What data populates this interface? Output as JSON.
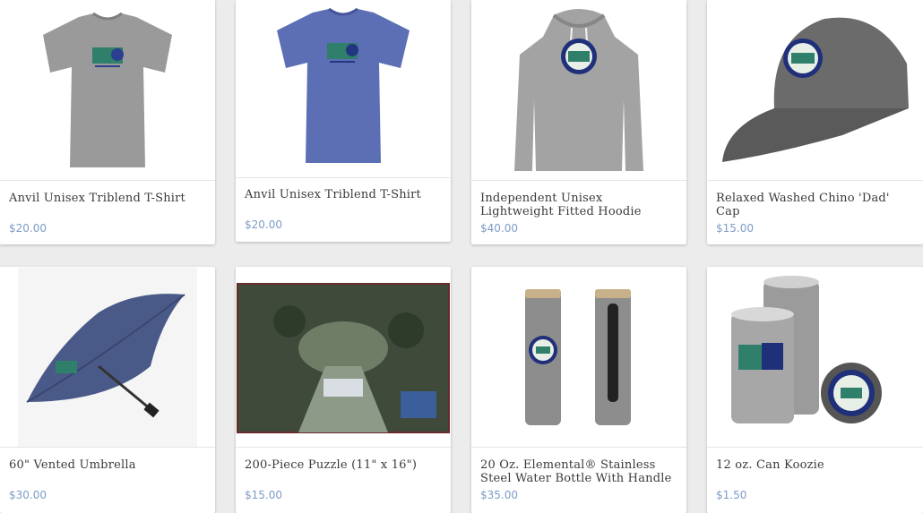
{
  "products": [
    {
      "title": "Anvil Unisex Triblend T-Shirt",
      "price": "$20.00",
      "image": "gray-tshirt"
    },
    {
      "title": "Anvil Unisex Triblend T-Shirt",
      "price": "$20.00",
      "image": "blue-tshirt"
    },
    {
      "title": "Independent Unisex Lightweight Fitted Hoodie",
      "price": "$40.00",
      "image": "gray-hoodie"
    },
    {
      "title": "Relaxed Washed Chino 'Dad' Cap",
      "price": "$15.00",
      "image": "gray-cap"
    },
    {
      "title": "60\" Vented Umbrella",
      "price": "$30.00",
      "image": "navy-umbrella"
    },
    {
      "title": "200-Piece Puzzle (11\" x 16\")",
      "price": "$15.00",
      "image": "aerial-puzzle"
    },
    {
      "title": "20 Oz. Elemental® Stainless Steel Water Bottle With Handle",
      "price": "$35.00",
      "image": "water-bottles"
    },
    {
      "title": "12 oz. Can Koozie",
      "price": "$1.50",
      "image": "can-koozie"
    }
  ],
  "colors": {
    "background": "#ececec",
    "card": "#ffffff",
    "title": "#3a3a3a",
    "price": "#7b9cc6"
  }
}
